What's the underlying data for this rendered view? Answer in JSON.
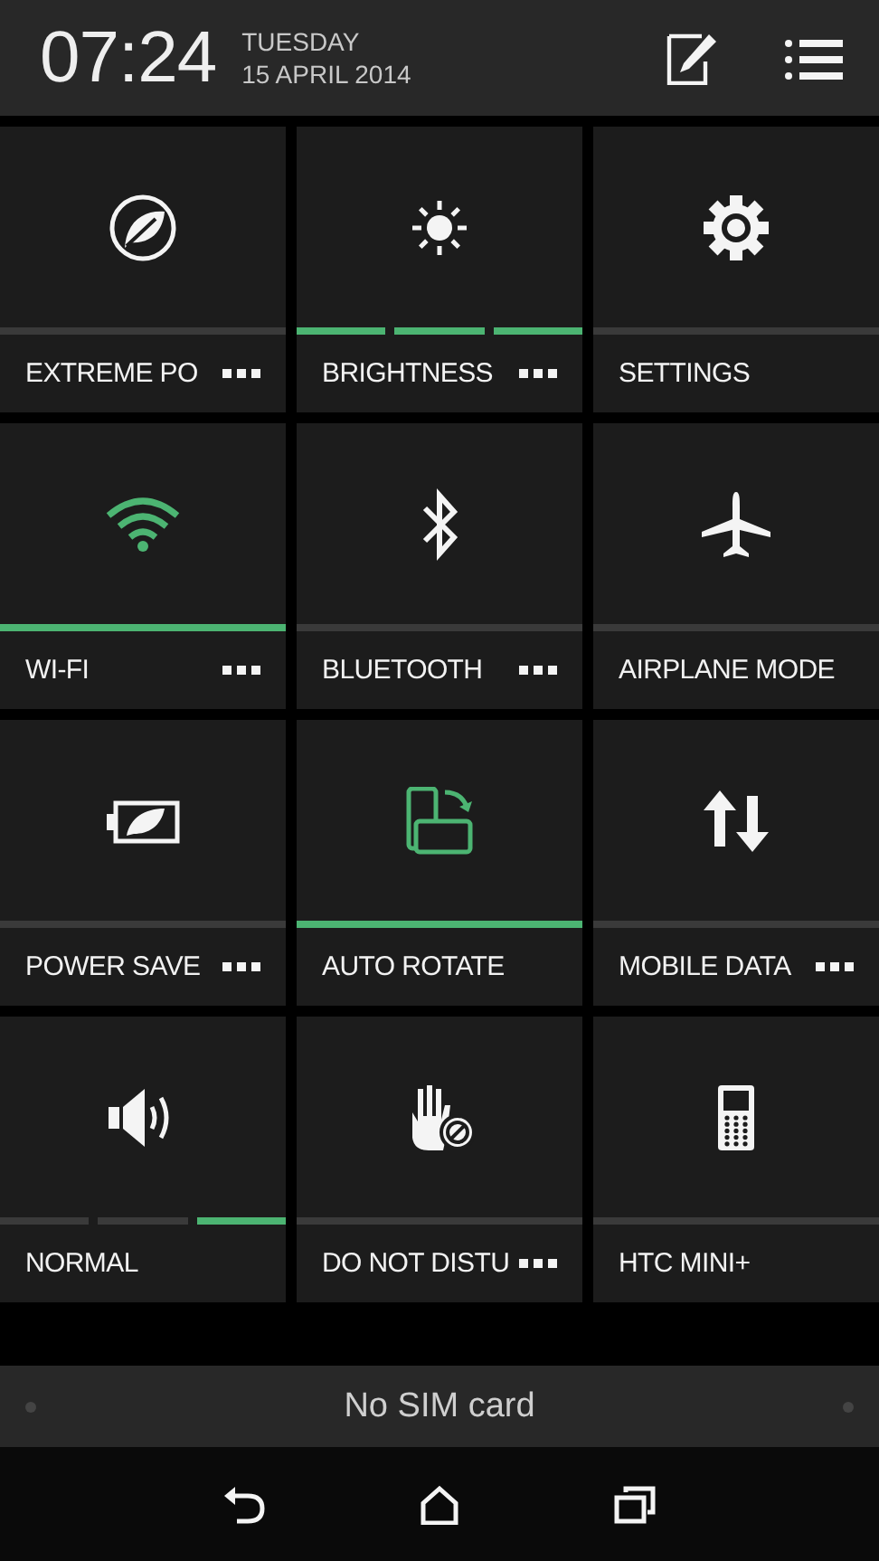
{
  "header": {
    "time": "07:24",
    "day": "TUESDAY",
    "date": "15 APRIL 2014"
  },
  "tiles": [
    {
      "label": "EXTREME PO",
      "kind": "toggle",
      "on": false,
      "more": true
    },
    {
      "label": "BRIGHTNESS",
      "kind": "segmented",
      "segments": [
        {
          "on": true
        },
        {
          "on": true
        },
        {
          "on": true
        }
      ],
      "more": true
    },
    {
      "label": "SETTINGS",
      "kind": "toggle",
      "on": false,
      "more": false
    },
    {
      "label": "WI-FI",
      "kind": "toggle",
      "on": true,
      "more": true
    },
    {
      "label": "BLUETOOTH",
      "kind": "toggle",
      "on": false,
      "more": true
    },
    {
      "label": "AIRPLANE MODE",
      "kind": "toggle",
      "on": false,
      "more": false
    },
    {
      "label": "POWER SAVE",
      "kind": "toggle",
      "on": false,
      "more": true
    },
    {
      "label": "AUTO ROTATE",
      "kind": "toggle",
      "on": true,
      "more": false
    },
    {
      "label": "MOBILE DATA",
      "kind": "toggle",
      "on": false,
      "more": true
    },
    {
      "label": "NORMAL",
      "kind": "segmented",
      "segments": [
        {
          "on": false
        },
        {
          "on": false
        },
        {
          "on": true
        }
      ],
      "more": false
    },
    {
      "label": "DO NOT DISTU",
      "kind": "toggle",
      "on": false,
      "more": true
    },
    {
      "label": "HTC MINI+",
      "kind": "toggle",
      "on": false,
      "more": false
    }
  ],
  "sim_status": "No SIM card"
}
